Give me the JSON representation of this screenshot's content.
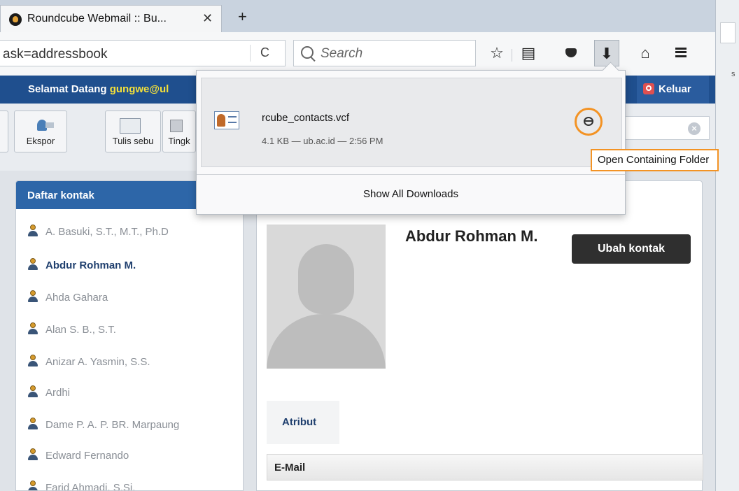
{
  "browser": {
    "tab_title": "Roundcube Webmail :: Bu...",
    "tab_close": "✕",
    "new_tab": "+",
    "url_partial": "ask=addressbook",
    "reload": "C",
    "search_placeholder": "Search",
    "toolbar_icons": [
      "star-icon",
      "reader-icon",
      "pocket-icon",
      "download-icon",
      "home-icon",
      "menu-icon"
    ],
    "right_strip_letter": "s"
  },
  "roundcube": {
    "welcome_prefix": "Selamat Datang",
    "user": "gungwe@ul",
    "logout": "Keluar",
    "toolbar": [
      "Ekspor",
      "Tulis sebu",
      "Tingk"
    ],
    "sidebar_title": "Daftar kontak",
    "contacts": [
      "A. Basuki, S.T., M.T., Ph.D",
      "Abdur Rohman M.",
      "Ahda Gahara",
      "Alan S. B., S.T.",
      "Anizar A. Yasmin, S.S.",
      "Ardhi",
      "Dame P. A. P. BR. Marpaung",
      "Edward Fernando",
      "Farid Ahmadi, S.Si."
    ],
    "selected_contact": "Abdur Rohman M.",
    "contact_name": "Abdur Rohman M.",
    "edit_button": "Ubah kontak",
    "attr_tab": "Atribut",
    "email_header": "E-Mail"
  },
  "downloads": {
    "filename": "rcube_contacts.vcf",
    "meta": "4.1 KB — ub.ac.id — 2:56 PM",
    "show_all": "Show All Downloads",
    "tooltip": "Open Containing Folder"
  },
  "colors": {
    "header_blue": "#1f4f8e",
    "highlight_orange": "#f39324",
    "username_yellow": "#f4e03a"
  }
}
